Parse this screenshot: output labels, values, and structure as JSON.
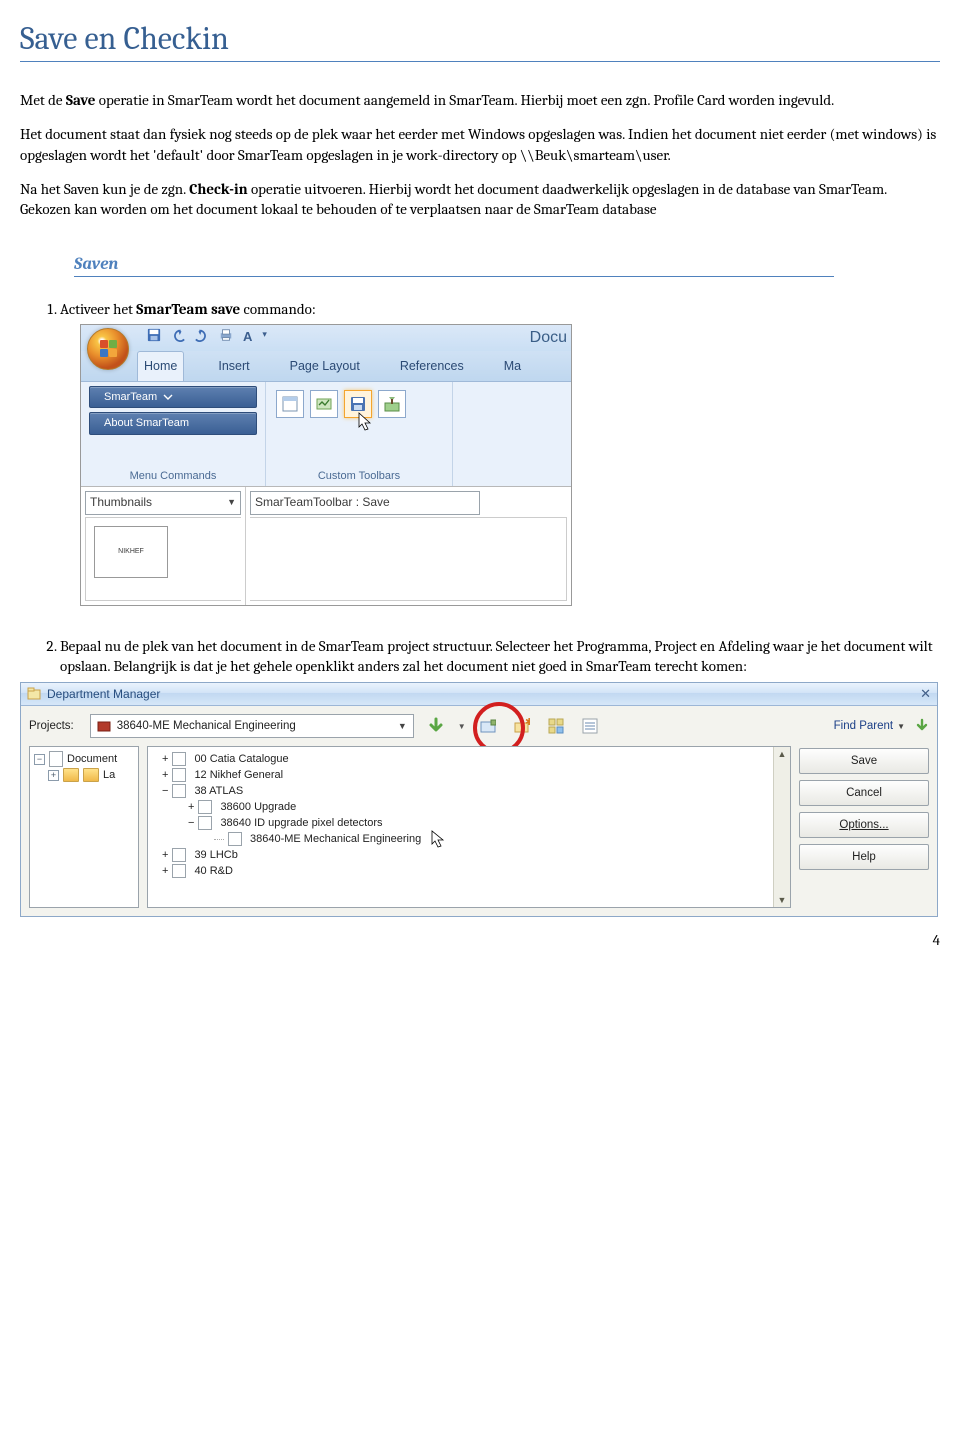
{
  "heading": "Save en Checkin",
  "paragraphs": {
    "p1a": "Met de ",
    "p1b": "Save",
    "p1c": " operatie in SmarTeam wordt het document aangemeld in SmarTeam. Hierbij moet een zgn. Profile Card worden ingevuld.",
    "p2": "Het document staat dan fysiek nog steeds op de plek waar het eerder met Windows opgeslagen was. Indien het document niet eerder (met windows) is opgeslagen wordt het 'default' door SmarTeam opgeslagen in je work-directory op \\\\Beuk\\smarteam\\user.",
    "p3a": "Na het Saven kun je de zgn. ",
    "p3b": "Check-in",
    "p3c": " operatie uitvoeren. Hierbij wordt het document daadwerkelijk opgeslagen in de database van SmarTeam. Gekozen kan worden om het document lokaal te behouden of te verplaatsen naar de SmarTeam database"
  },
  "subheading": "Saven",
  "steps": {
    "s1a": "Activeer het ",
    "s1b": "SmarTeam save",
    "s1c": " commando:",
    "s2": "Bepaal nu de plek van het document in de SmarTeam project structuur. Selecteer het Programma, Project en Afdeling waar je het document wilt opslaan. Belangrijk is dat je het gehele openklikt anders zal het document niet goed in SmarTeam terecht komen:"
  },
  "page_number": "4",
  "word": {
    "doc_title": "Docu",
    "tabs": [
      "Home",
      "Insert",
      "Page Layout",
      "References",
      "Ma"
    ],
    "group_menu": "Menu Commands",
    "group_custom": "Custom Toolbars",
    "btn_smarteam": "SmarTeam",
    "btn_about": "About SmarTeam",
    "thumb_label": "Thumbnails",
    "tooltip": "SmarTeamToolbar : Save",
    "thumb_caption": "NIKHEF"
  },
  "dm": {
    "title": "Department Manager",
    "projects_label": "Projects:",
    "selected_project": "38640-ME Mechanical Engineering",
    "find_parent": "Find Parent",
    "buttons": [
      "Save",
      "Cancel",
      "Options...",
      "Help"
    ],
    "left_tree": {
      "docs": "Document",
      "la": "La"
    },
    "tree_items": [
      "00 Catia Catalogue",
      "12 Nikhef General",
      "38 ATLAS",
      "38600 Upgrade",
      "38640 ID upgrade pixel detectors",
      "38640-ME Mechanical Engineering",
      "39 LHCb",
      "40 R&D"
    ]
  }
}
